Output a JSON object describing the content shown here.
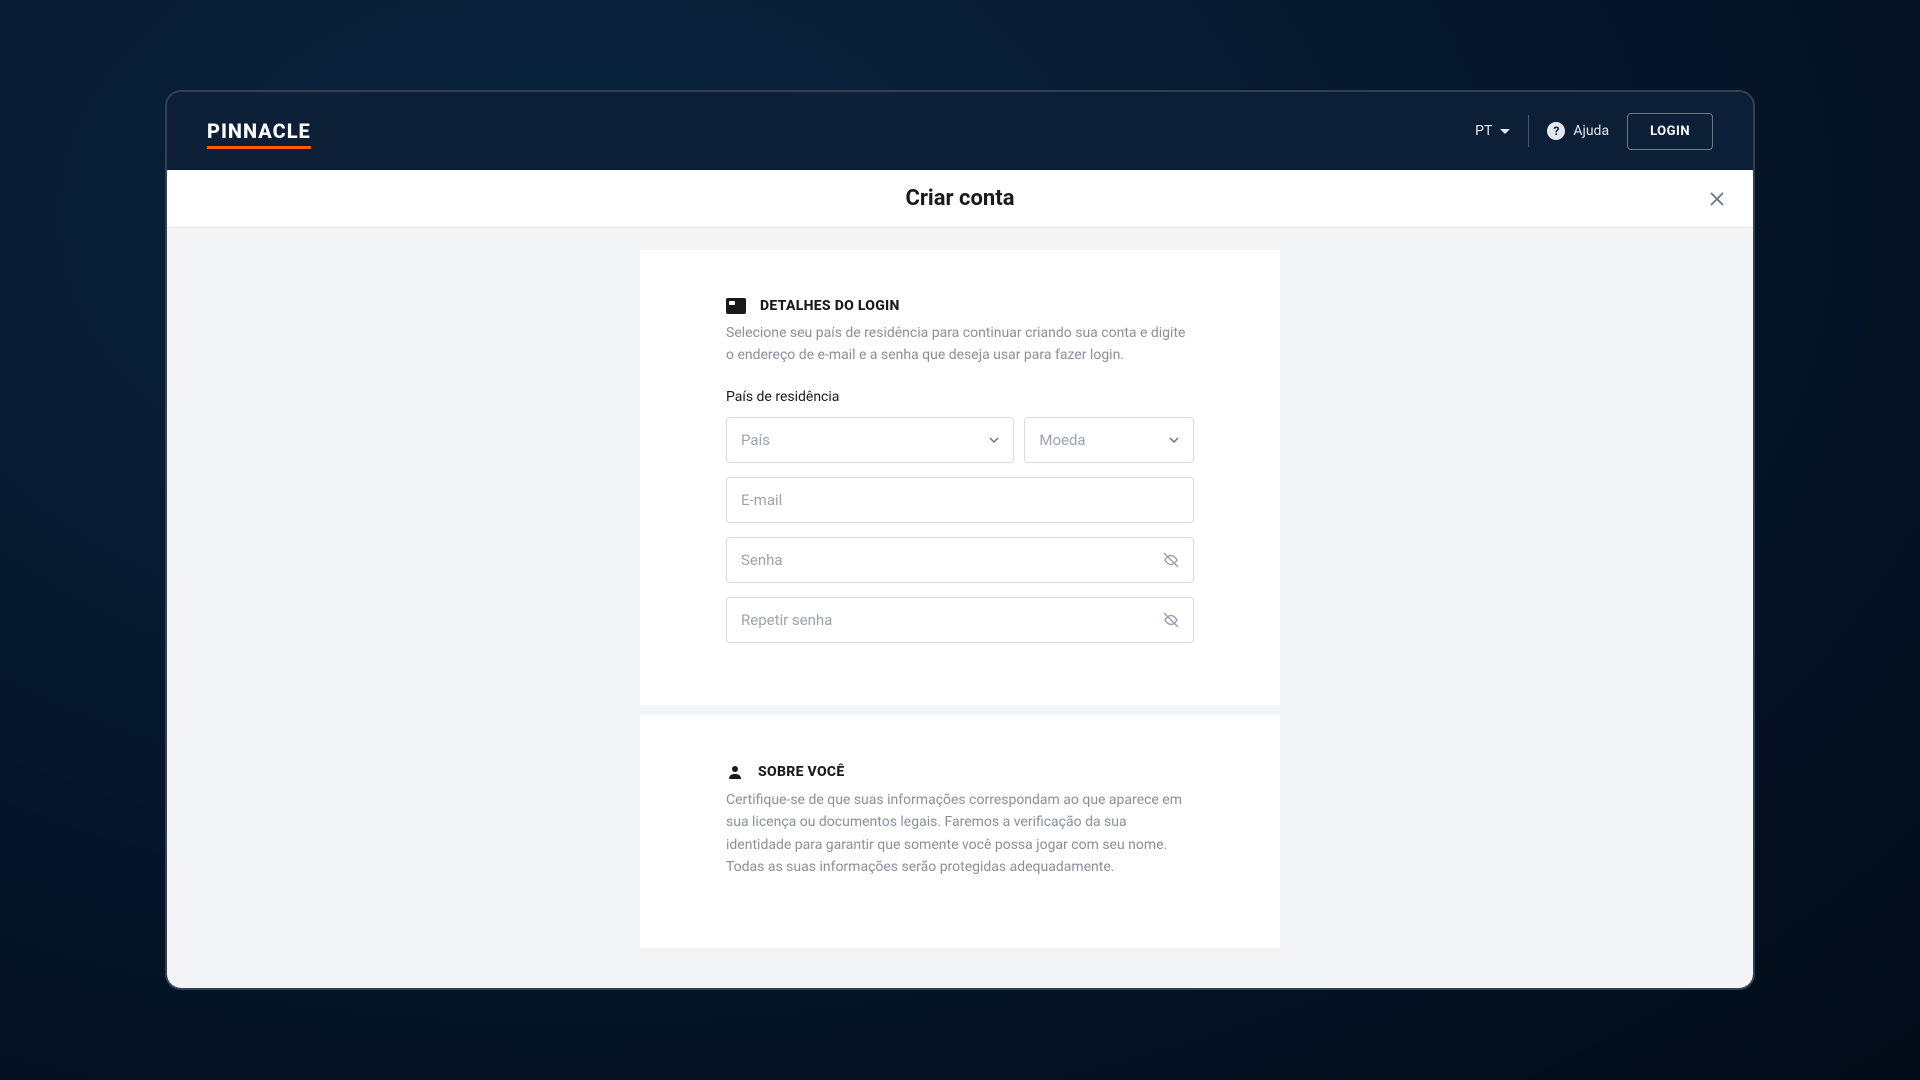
{
  "header": {
    "brand": "PINNACLE",
    "language": "PT",
    "help_label": "Ajuda",
    "login_label": "LOGIN"
  },
  "page": {
    "title": "Criar conta"
  },
  "sections": {
    "login_details": {
      "title": "DETALHES DO LOGIN",
      "description": "Selecione seu país de residência para continuar criando sua conta e digite o endereço de e-mail e a senha que deseja usar para fazer login.",
      "country_label": "País de residência",
      "country_placeholder": "País",
      "currency_placeholder": "Moeda",
      "email_placeholder": "E-mail",
      "password_placeholder": "Senha",
      "repeat_password_placeholder": "Repetir senha"
    },
    "about_you": {
      "title": "SOBRE VOCÊ",
      "description": "Certifique-se de que suas informações correspondam ao que aparece em sua licença ou documentos legais. Faremos a verificação da sua identidade para garantir que somente você possa jogar com seu nome. Todas as suas informações serão protegidas adequadamente."
    }
  }
}
